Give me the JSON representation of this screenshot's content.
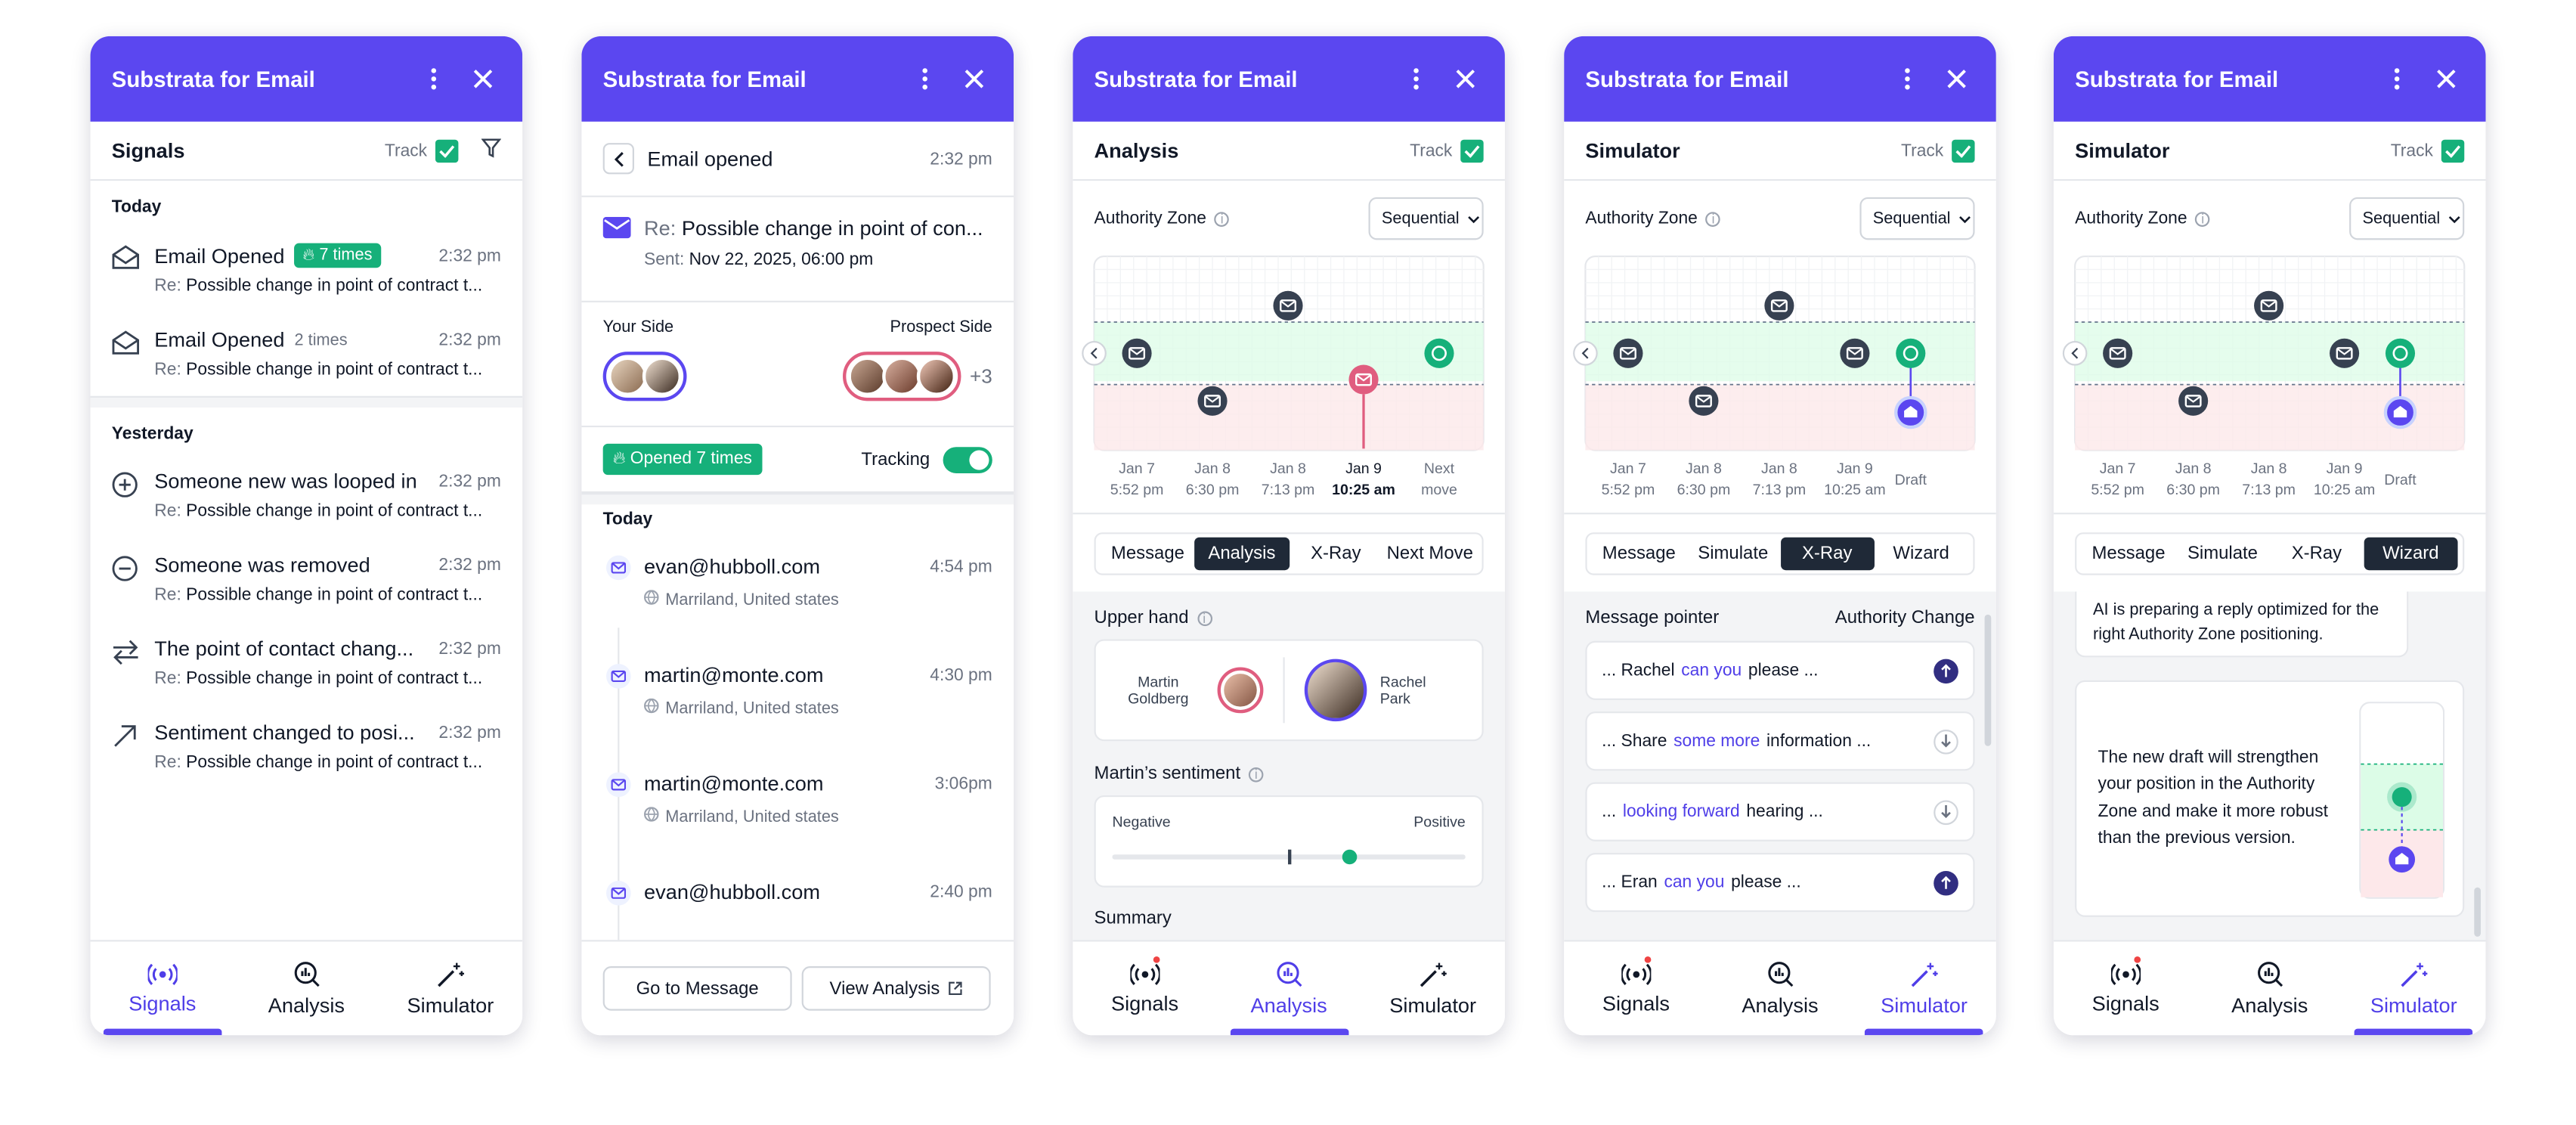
{
  "app_title": "Substrata for Email",
  "nav": {
    "signals": "Signals",
    "analysis": "Analysis",
    "simulator": "Simulator"
  },
  "track_label": "Track",
  "p1": {
    "title": "Signals",
    "today": "Today",
    "yesterday": "Yesterday",
    "items": [
      {
        "title": "Email Opened",
        "badge": "7 times",
        "time": "2:32 pm",
        "re": "Re:",
        "subject": "Possible change in point of contract t..."
      },
      {
        "title": "Email Opened",
        "badge": "2 times",
        "time": "2:32 pm",
        "re": "Re:",
        "subject": "Possible change in point of contract t..."
      },
      {
        "title": "Someone new was looped in",
        "time": "2:32 pm",
        "re": "Re:",
        "subject": "Possible change in point of contract t..."
      },
      {
        "title": "Someone was removed",
        "time": "2:32 pm",
        "re": "Re:",
        "subject": "Possible change in point of contract t..."
      },
      {
        "title": "The point of contact chang...",
        "time": "2:32 pm",
        "re": "Re:",
        "subject": "Possible change in point of contract t..."
      },
      {
        "title": "Sentiment changed to posi...",
        "time": "2:32 pm",
        "re": "Re:",
        "subject": "Possible change in point of contract t..."
      }
    ]
  },
  "p2": {
    "title": "Email opened",
    "time": "2:32 pm",
    "re": "Re:",
    "subject": "Possible change in point of con...",
    "sent_label": "Sent:",
    "sent": "Nov 22, 2025, 06:00 pm",
    "your_side": "Your Side",
    "prospect_side": "Prospect Side",
    "more": "+3",
    "opened": "Opened 7 times",
    "tracking": "Tracking",
    "today": "Today",
    "opens": [
      {
        "email": "evan@hubboll.com",
        "time": "4:54 pm",
        "loc": "Marriland, United states"
      },
      {
        "email": "martin@monte.com",
        "time": "4:30 pm",
        "loc": "Marriland, United states"
      },
      {
        "email": "martin@monte.com",
        "time": "3:06pm",
        "loc": "Marriland, United states"
      },
      {
        "email": "evan@hubboll.com",
        "time": "2:40 pm"
      }
    ],
    "go_btn": "Go to Message",
    "view_btn": "View Analysis"
  },
  "chart": {
    "zone_label": "Authority Zone",
    "mode": "Sequential",
    "x3": [
      {
        "d": "Jan 7",
        "t": "5:52 pm"
      },
      {
        "d": "Jan 8",
        "t": "6:30 pm"
      },
      {
        "d": "Jan 8",
        "t": "7:13 pm"
      },
      {
        "d": "Jan 9",
        "t": "10:25 am"
      },
      {
        "d": "Next",
        "t": "move"
      }
    ],
    "x45": [
      {
        "d": "Jan 7",
        "t": "5:52 pm"
      },
      {
        "d": "Jan 8",
        "t": "6:30 pm"
      },
      {
        "d": "Jan 8",
        "t": "7:13 pm"
      },
      {
        "d": "Jan 9",
        "t": "10:25 am"
      },
      {
        "d": "Draft",
        "t": ""
      }
    ]
  },
  "p3": {
    "title": "Analysis",
    "tabs": [
      "Message",
      "Analysis",
      "X-Ray",
      "Next Move"
    ],
    "upper_hand": "Upper hand",
    "p_left": "Martin Goldberg",
    "p_right": "Rachel Park",
    "sentiment": "Martin’s sentiment",
    "neg": "Negative",
    "pos": "Positive",
    "summary": "Summary"
  },
  "p4": {
    "title": "Simulator",
    "tabs": [
      "Message",
      "Simulate",
      "X-Ray",
      "Wizard"
    ],
    "pointer": "Message pointer",
    "change": "Authority Change",
    "rows": [
      {
        "a": "... Rachel",
        "h": "can you",
        "b": "please ..."
      },
      {
        "a": "... Share",
        "h": "some more",
        "b": "information ..."
      },
      {
        "a": "...",
        "h": "looking forward",
        "b": "hearing ..."
      },
      {
        "a": "... Eran",
        "h": "can you",
        "b": "please ..."
      }
    ]
  },
  "p5": {
    "title": "Simulator",
    "tabs": [
      "Message",
      "Simulate",
      "X-Ray",
      "Wizard"
    ],
    "prep": "AI is preparing a reply optimized for the right Authority Zone positioning.",
    "draft": "The new draft will strengthen your position in the Authority Zone and make it more robust than the previous version."
  }
}
